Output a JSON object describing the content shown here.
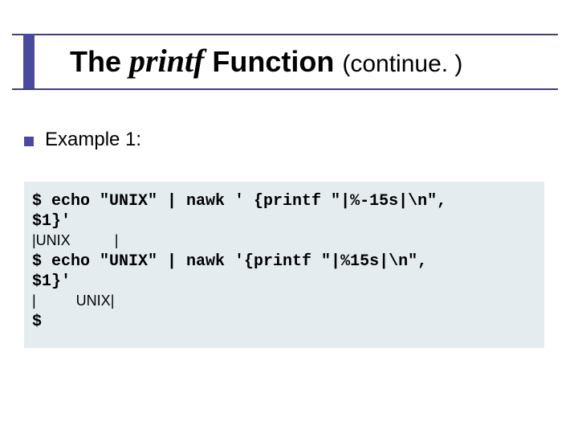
{
  "title": {
    "prefix": "The ",
    "emph": "printf",
    "mid": " Function ",
    "cont": "(continue. )"
  },
  "bullet": "Example 1:",
  "code": {
    "l1": "$ echo \"UNIX\" | nawk ' {printf \"|%-15s|\\n\",",
    "l2": "$1}'",
    "l3": "|UNIX           |",
    "l4": "$ echo \"UNIX\" | nawk '{printf \"|%15s|\\n\",",
    "l5": "$1}'",
    "l6": "|          UNIX|",
    "l7": "$"
  }
}
